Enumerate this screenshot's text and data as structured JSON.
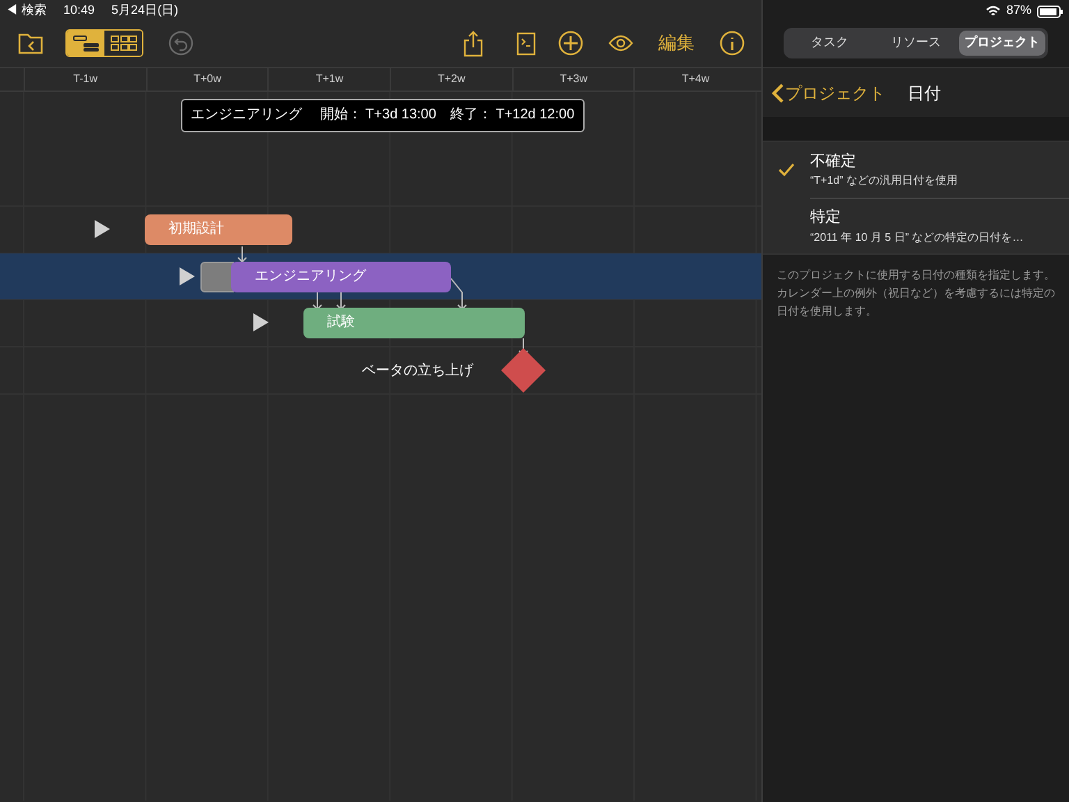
{
  "status_bar": {
    "back_label": "◀ 検索",
    "time": "10:49",
    "date": "5月24日(日)",
    "battery": "87%"
  },
  "toolbar": {
    "view_modes": [
      {
        "kind": "gantt",
        "selected": true
      },
      {
        "kind": "network",
        "selected": false
      }
    ],
    "edit_label": "編集"
  },
  "timeline": {
    "columns": [
      "T-1w",
      "T+0w",
      "T+1w",
      "T+2w",
      "T+3w",
      "T+4w"
    ]
  },
  "tooltip": {
    "name": "エンジニアリング",
    "start_label": "開始：",
    "start": "T+3d 13:00",
    "end_label": "終了：",
    "end": "T+12d 12:00"
  },
  "tasks": [
    {
      "name": "初期設計",
      "kind": "task",
      "color": "#dd8a66",
      "selected": false,
      "lead_in": false
    },
    {
      "name": "エンジニアリング",
      "kind": "task",
      "color": "#8c62c2",
      "selected": true,
      "lead_in": true
    },
    {
      "name": "試験",
      "kind": "task",
      "color": "#6fae7f",
      "selected": false,
      "lead_in": false
    },
    {
      "name": "ベータの立ち上げ",
      "kind": "milestone",
      "color": "#cf4d4d",
      "selected": false,
      "lead_in": false
    }
  ],
  "inspector": {
    "tabs": [
      {
        "label": "タスク",
        "selected": false
      },
      {
        "label": "リソース",
        "selected": false
      },
      {
        "label": "プロジェクト",
        "selected": true
      }
    ],
    "back_label": "プロジェクト",
    "title": "日付",
    "options": [
      {
        "title": "不確定",
        "subtitle": "“T+1d” などの汎用日付を使用",
        "checked": true
      },
      {
        "title": "特定",
        "subtitle": "“2011 年 10 月 5 日” などの特定の日付を…",
        "checked": false
      }
    ],
    "footnote": "このプロジェクトに使用する日付の種類を指定します。カレンダー上の例外（祝日など）を考慮するには特定の日付を使用します。"
  }
}
